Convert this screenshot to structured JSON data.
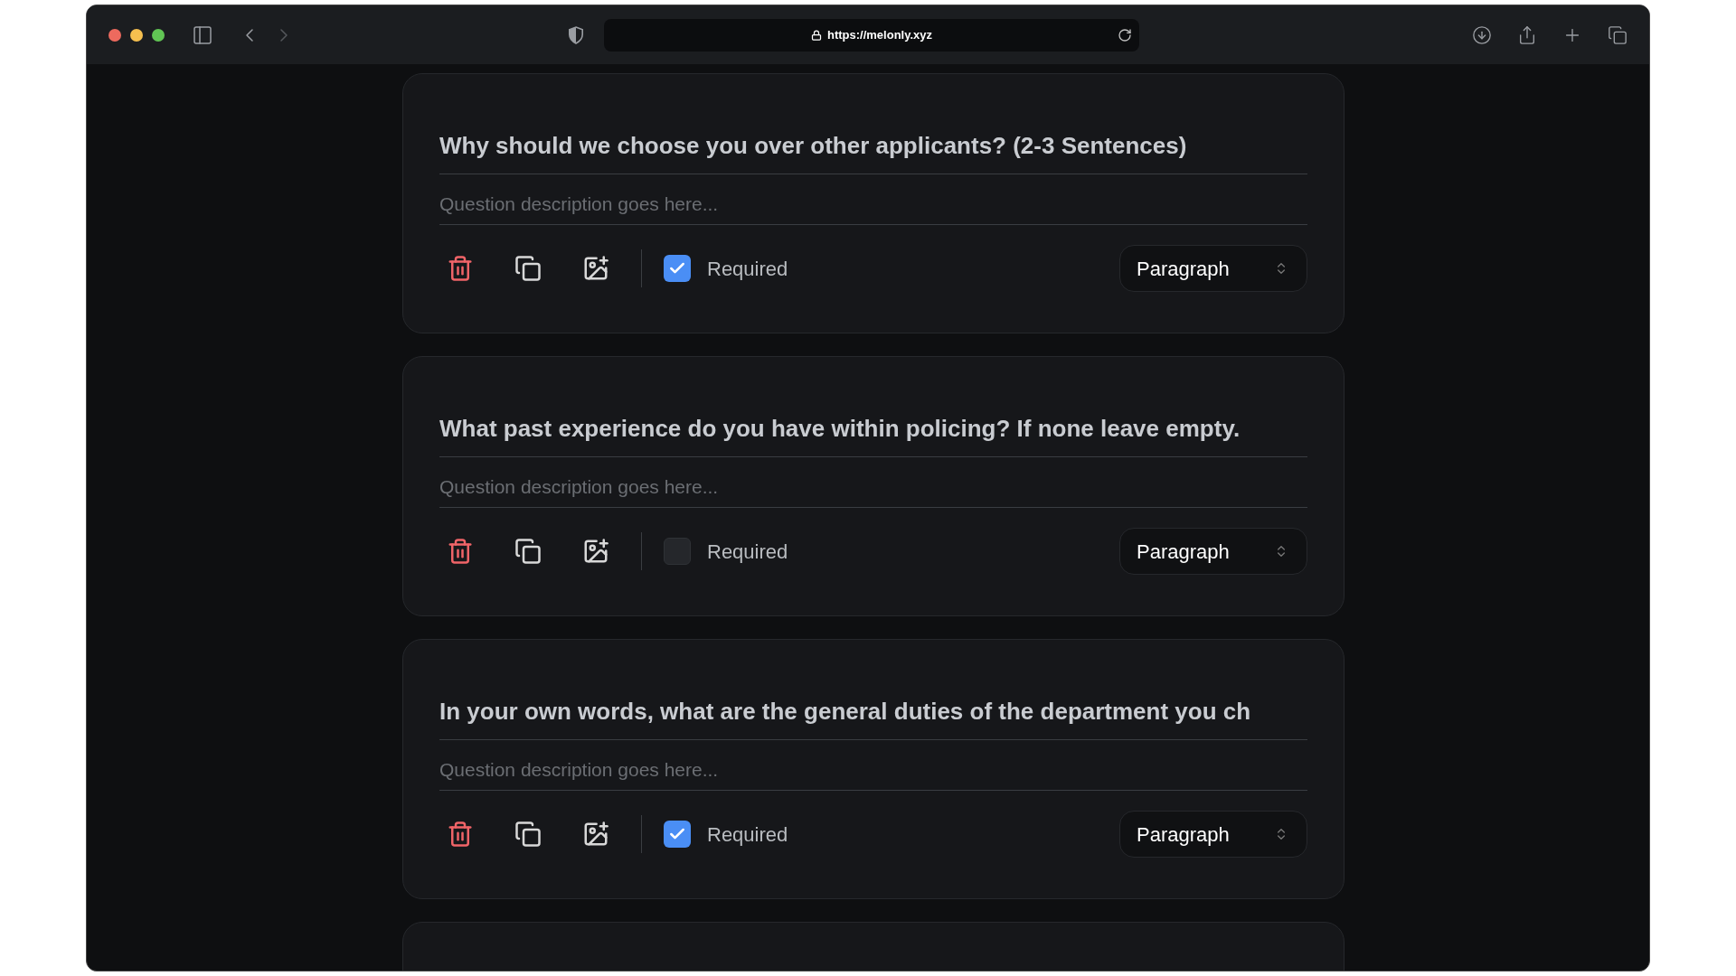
{
  "browser": {
    "url": "https://melonly.xyz"
  },
  "questions": [
    {
      "title": "Why should we choose you over other applicants? (2-3 Sentences)",
      "description_placeholder": "Question description goes here...",
      "required": true,
      "required_label": "Required",
      "type": "Paragraph"
    },
    {
      "title": "What past experience do you have within policing? If none leave empty.",
      "description_placeholder": "Question description goes here...",
      "required": false,
      "required_label": "Required",
      "type": "Paragraph"
    },
    {
      "title": "In your own words, what are the general duties of the department you ch",
      "description_placeholder": "Question description goes here...",
      "required": true,
      "required_label": "Required",
      "type": "Paragraph"
    }
  ]
}
